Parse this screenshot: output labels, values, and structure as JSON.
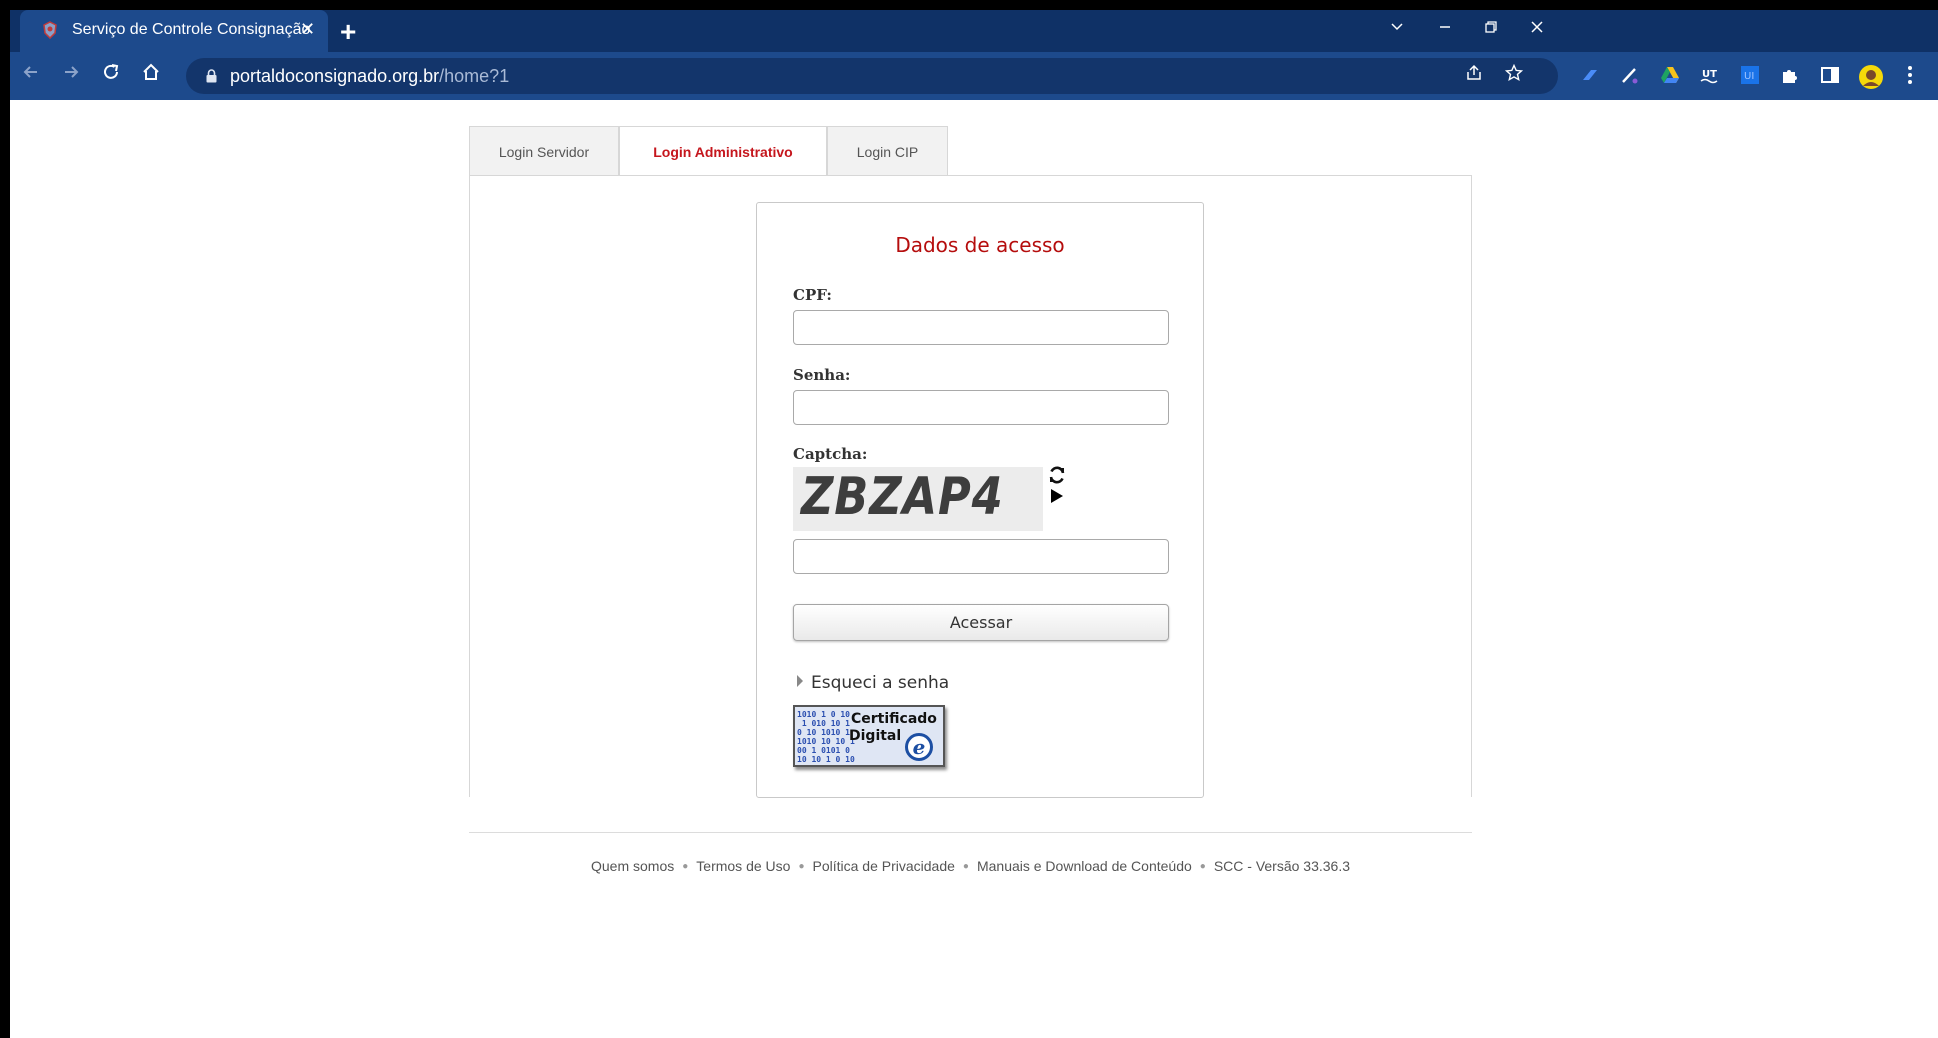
{
  "browser": {
    "tab_title": "Serviço de Controle Consignação",
    "tab_close": "✕",
    "new_tab": "+",
    "url_host": "portaldoconsignado.org.br",
    "url_path": "/home?1",
    "colors": {
      "tabbar": "#0f3166",
      "toolbar": "#1d4a8c"
    }
  },
  "login_tabs": [
    {
      "label": "Login Servidor",
      "active": false
    },
    {
      "label": "Login Administrativo",
      "active": true
    },
    {
      "label": "Login CIP",
      "active": false
    }
  ],
  "form": {
    "heading": "Dados de acesso",
    "cpf_label": "CPF:",
    "cpf_value": "",
    "senha_label": "Senha:",
    "senha_value": "",
    "captcha_label": "Captcha:",
    "captcha_text": "ZBZAP4",
    "captcha_value": "",
    "submit_label": "Acessar",
    "forgot_label": "Esqueci a senha",
    "certificate": {
      "line1": "Certificado",
      "line2": "Digital",
      "badge": "e"
    }
  },
  "footer": {
    "links": [
      "Quem somos",
      "Termos de Uso",
      "Política de Privacidade",
      "Manuais e Download de Conteúdo",
      "SCC - Versão 33.36.3"
    ]
  },
  "colors": {
    "accent_red": "#c5161d",
    "heading_red": "#b50d0d"
  }
}
